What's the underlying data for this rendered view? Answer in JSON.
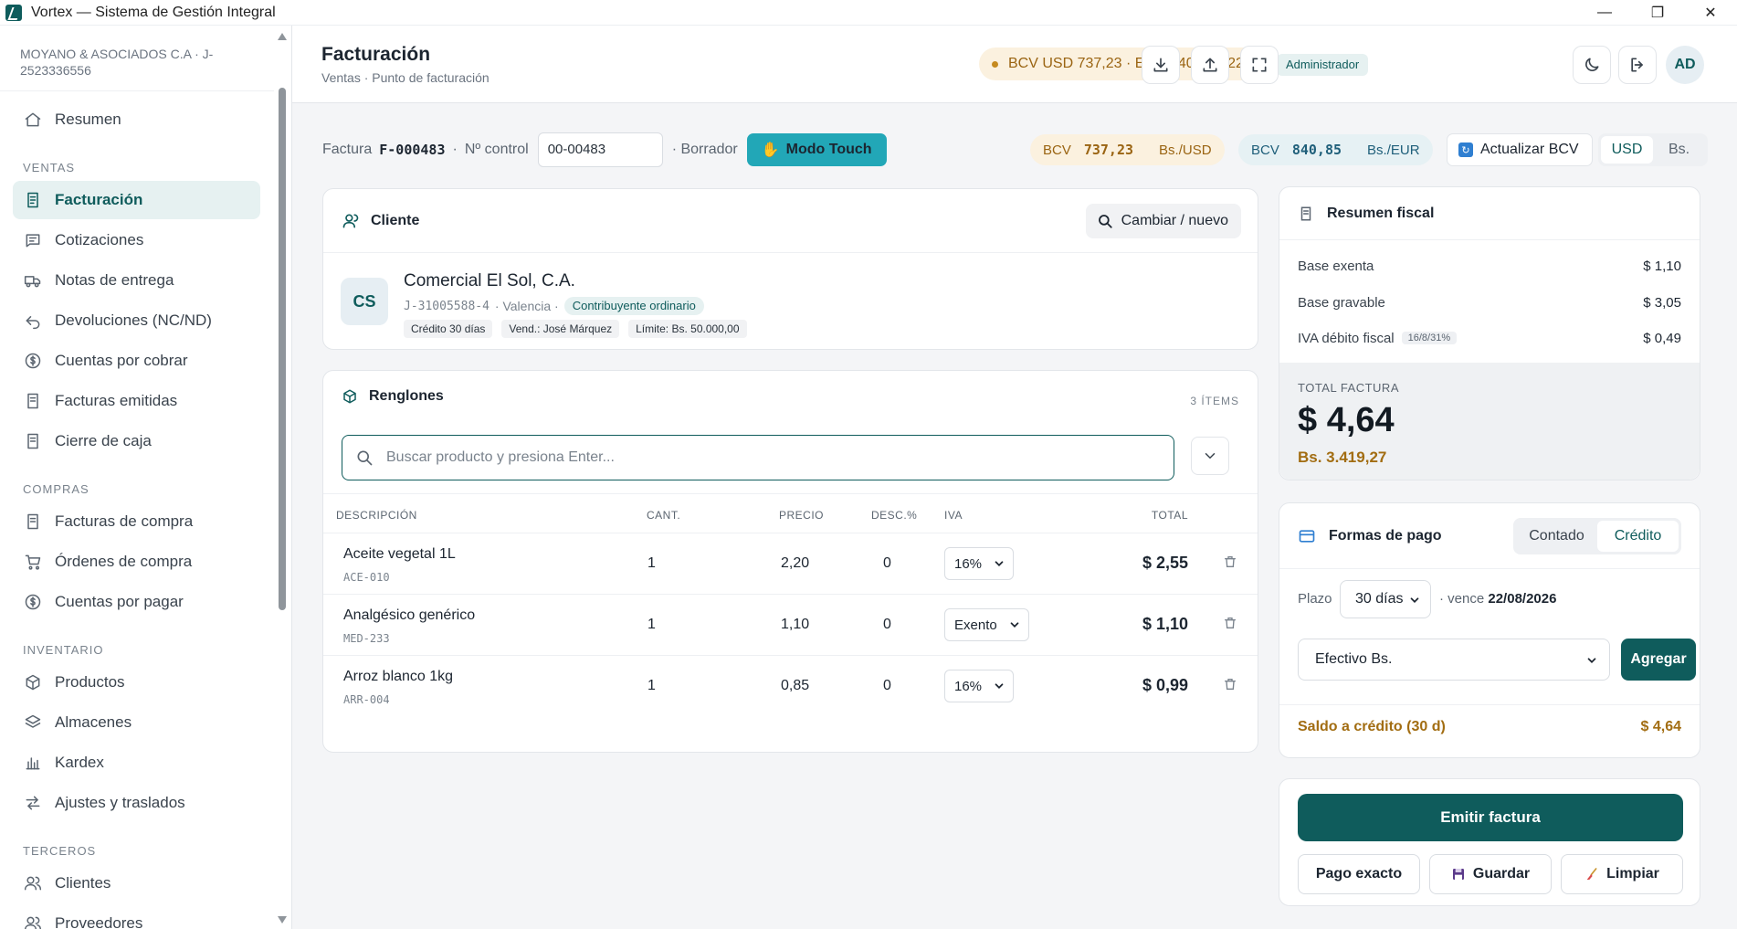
{
  "window": {
    "title": "Vortex — Sistema de Gestión Integral",
    "minimize": "—",
    "maximize": "❐",
    "close": "✕"
  },
  "sidebar": {
    "company": "MOYANO & ASOCIADOS C.A · J-2523336556",
    "sections": [
      {
        "label": "",
        "items": [
          {
            "label": "Resumen",
            "icon": "home-icon"
          }
        ]
      },
      {
        "label": "VENTAS",
        "items": [
          {
            "label": "Facturación",
            "icon": "invoice-icon",
            "active": true
          },
          {
            "label": "Cotizaciones",
            "icon": "quote-icon"
          },
          {
            "label": "Notas de entrega",
            "icon": "truck-icon"
          },
          {
            "label": "Devoluciones (NC/ND)",
            "icon": "return-icon"
          },
          {
            "label": "Cuentas por cobrar",
            "icon": "dollar-circle-icon"
          },
          {
            "label": "Facturas emitidas",
            "icon": "document-icon"
          },
          {
            "label": "Cierre de caja",
            "icon": "document-icon"
          }
        ]
      },
      {
        "label": "COMPRAS",
        "items": [
          {
            "label": "Facturas de compra",
            "icon": "document-icon"
          },
          {
            "label": "Órdenes de compra",
            "icon": "cart-icon"
          },
          {
            "label": "Cuentas por pagar",
            "icon": "dollar-circle-icon"
          }
        ]
      },
      {
        "label": "INVENTARIO",
        "items": [
          {
            "label": "Productos",
            "icon": "box-icon"
          },
          {
            "label": "Almacenes",
            "icon": "layers-icon"
          },
          {
            "label": "Kardex",
            "icon": "bar-chart-icon"
          },
          {
            "label": "Ajustes y traslados",
            "icon": "transfer-icon"
          }
        ]
      },
      {
        "label": "TERCEROS",
        "items": [
          {
            "label": "Clientes",
            "icon": "users-icon"
          },
          {
            "label": "Proveedores",
            "icon": "users-icon"
          }
        ]
      }
    ]
  },
  "header": {
    "title": "Facturación",
    "subtitle": "Ventas · Punto de facturación",
    "bcv": "BCV USD 737,23 · EUR 840,85 · 22 jul",
    "role": "Administrador",
    "avatar": "AD"
  },
  "invoice_bar": {
    "factura_label": "Factura",
    "factura_number": "F-000483",
    "sep": "·",
    "control_label": "Nº control",
    "control_value": "00-00483",
    "status": "· Borrador",
    "touch_label": "Modo Touch",
    "usd_rate": {
      "label": "BCV",
      "value": "737,23",
      "unit": "Bs./USD"
    },
    "eur_rate": {
      "label": "BCV",
      "value": "840,85",
      "unit": "Bs./EUR"
    },
    "update_label": "Actualizar BCV",
    "currency_options": [
      "USD",
      "Bs."
    ],
    "currency_selected": "USD"
  },
  "client": {
    "title": "Cliente",
    "change_label": "Cambiar / nuevo",
    "initials": "CS",
    "name": "Comercial El Sol, C.A.",
    "rif": "J-31005588-4",
    "city": "· Valencia ·",
    "type": "Contribuyente ordinario",
    "tags": [
      "Crédito 30 días",
      "Vend.: José Márquez",
      "Límite: Bs. 50.000,00"
    ]
  },
  "lines": {
    "title": "Renglones",
    "count": "3 ÍTEMS",
    "search_placeholder": "Buscar producto y presiona Enter...",
    "columns": {
      "desc": "DESCRIPCIÓN",
      "qty": "CANT.",
      "price": "PRECIO",
      "disc": "DESC.%",
      "iva": "IVA",
      "total": "TOTAL"
    },
    "rows": [
      {
        "name": "Aceite vegetal 1L",
        "code": "ACE-010",
        "qty": "1",
        "price": "2,20",
        "disc": "0",
        "iva": "16%",
        "total": "$ 2,55"
      },
      {
        "name": "Analgésico genérico",
        "code": "MED-233",
        "qty": "1",
        "price": "1,10",
        "disc": "0",
        "iva": "Exento",
        "total": "$ 1,10"
      },
      {
        "name": "Arroz blanco 1kg",
        "code": "ARR-004",
        "qty": "1",
        "price": "0,85",
        "disc": "0",
        "iva": "16%",
        "total": "$ 0,99"
      }
    ]
  },
  "summary": {
    "title": "Resumen fiscal",
    "base_exenta_label": "Base exenta",
    "base_exenta": "$ 1,10",
    "base_gravable_label": "Base gravable",
    "base_gravable": "$ 3,05",
    "iva_label": "IVA débito fiscal",
    "iva_rates": "16/8/31%",
    "iva": "$ 0,49",
    "total_label": "TOTAL FACTURA",
    "total": "$ 4,64",
    "total_bs": "Bs. 3.419,27"
  },
  "payment": {
    "title": "Formas de pago",
    "mode_options": [
      "Contado",
      "Crédito"
    ],
    "mode_selected": "Crédito",
    "plazo_label": "Plazo",
    "plazo_value": "30 días",
    "vence_label": "· vence",
    "vence_date": "22/08/2026",
    "method_value": "Efectivo Bs.",
    "add_label": "Agregar",
    "saldo_label": "Saldo a crédito (30 d)",
    "saldo_value": "$ 4,64"
  },
  "actions": {
    "emit": "Emitir factura",
    "exact": "Pago exacto",
    "save": "Guardar",
    "clear": "Limpiar"
  }
}
